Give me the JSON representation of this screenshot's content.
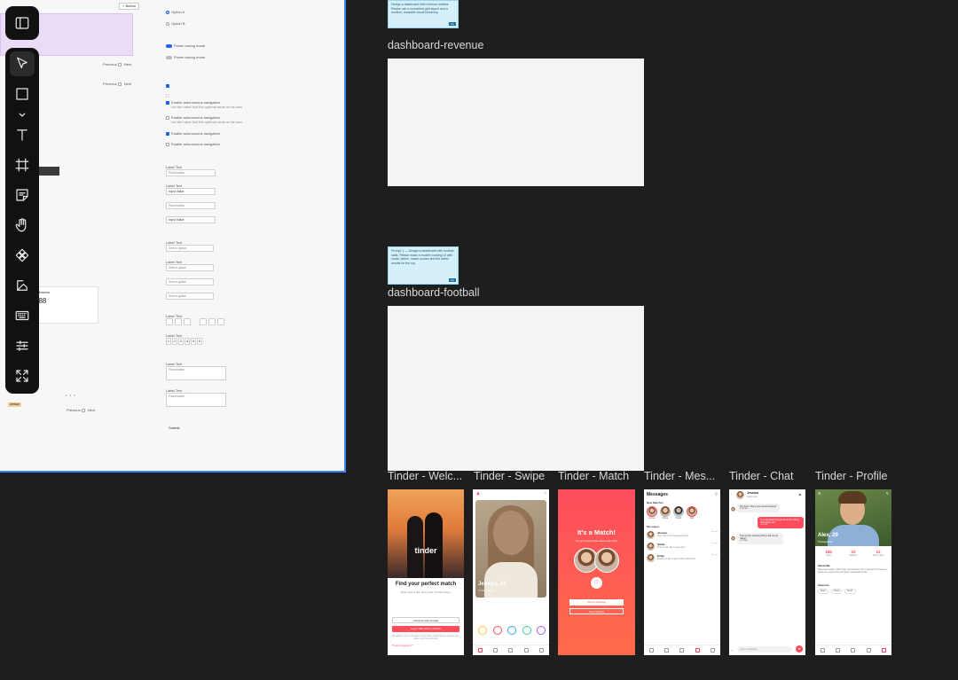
{
  "toolbar": {
    "tools": [
      {
        "name": "move-tool",
        "icon": "cursor-icon"
      },
      {
        "name": "rectangle-tool",
        "icon": "square-icon"
      },
      {
        "name": "text-tool",
        "icon": "text-icon"
      },
      {
        "name": "frame-tool",
        "icon": "frame-icon"
      },
      {
        "name": "sticky-note-tool",
        "icon": "sticky-note-icon"
      },
      {
        "name": "hand-tool",
        "icon": "hand-icon"
      },
      {
        "name": "component-tool",
        "icon": "component-icon"
      },
      {
        "name": "shapes-tool",
        "icon": "shapes-icon"
      },
      {
        "name": "keyboard-tool",
        "icon": "keyboard-icon"
      },
      {
        "name": "adjustments-tool",
        "icon": "sliders-icon"
      },
      {
        "name": "fullscreen-tool",
        "icon": "expand-icon"
      }
    ]
  },
  "artboard": {
    "add_label": "+ Button",
    "pager": {
      "prev": "Previous",
      "next": "Next"
    },
    "checkbox_labels": [
      "Enable autonomous navigation",
      "Enable autonomous navigation",
      "Enable autonomous navigation",
      "Enable autonomous navigation"
    ],
    "checkbox_help": "Let the robot find the optimal route on its own",
    "toggle_labels": [
      "Power saving mode",
      "Power saving mode"
    ],
    "radio_labels": [
      "Option A",
      "Option B"
    ],
    "field_label": "Label Text",
    "placeholder": "Placeholder",
    "input_value": "Input Value",
    "select_placeholder": "Select option",
    "stat_title": "Followers",
    "stat_value": "288",
    "small_button": "Submit",
    "footer_tag": "Default",
    "pager_bottom": {
      "prev": "Previous",
      "next": "Next"
    },
    "stepper_digits": [
      "1",
      "2",
      "3",
      "4",
      "5",
      "6"
    ]
  },
  "frames": {
    "revenue_label": "dashboard-revenue",
    "football_label": "dashboard-football",
    "prompt_revenue": "Design a dashboard with revenue metrics. Please use a consistent grid layout and a modern, readable visual hierarchy.",
    "prompt_football": "Prompt 1 — Design a dashboard with football stats. Please make a modern looking UI with cards, tables, match scores and the latest results for the top.",
    "prompt_button": "Go"
  },
  "tinder": {
    "labels": [
      "Tinder - Welc...",
      "Tinder - Swipe",
      "Tinder - Match",
      "Tinder - Mes...",
      "Tinder - Chat",
      "Tinder - Profile"
    ],
    "welcome": {
      "logo": "tinder",
      "headline": "Find your perfect match",
      "subtitle": "Swipe right to like, left to pass. It's that simple.",
      "google_button": "Continue with Google",
      "phone_button": "Log in with phone number",
      "terms": "By tapping Log in, you agree to our Terms. Learn how we process your data in our Privacy Policy.",
      "trouble": "Trouble logging in?"
    },
    "swipe": {
      "name": "Jessica, 24",
      "distance": "5 miles away"
    },
    "match": {
      "title": "It's a Match!",
      "subtitle": "You and Jessica have liked each other.",
      "send_button": "Send a Message",
      "keep_button": "Keep Swiping"
    },
    "messages": {
      "title": "Messages",
      "section_new": "New Matches",
      "section_msgs": "Messages",
      "matches": [
        "Emma",
        "Olivia",
        "Sarah",
        "Mia"
      ],
      "threads": [
        {
          "name": "Jessica",
          "preview": "Hey! How's your weekend going?",
          "time": "2m ago"
        },
        {
          "name": "Sarah",
          "preview": "That sounds like a great plan!",
          "time": "1h ago"
        },
        {
          "name": "Emily",
          "preview": "Would you like to grab coffee sometime?",
          "time": "3h ago"
        }
      ]
    },
    "chat": {
      "name": "Jessica",
      "status": "Active now",
      "messages": [
        {
          "side": "left",
          "text": "Hey there! How's your weekend going?",
          "time": "10:30 AM"
        },
        {
          "side": "right",
          "text": "It's going great! Just got back from hiking. How about you?",
          "time": "10:32 AM"
        },
        {
          "side": "left",
          "text": "That sounds amazing! Where did you go hiking?",
          "time": "10:33 AM"
        }
      ],
      "input_placeholder": "Type a message..."
    },
    "profile": {
      "name": "Alex, 29",
      "job": "Photographer",
      "stats": [
        {
          "value": "186",
          "label": "Likes"
        },
        {
          "value": "23",
          "label": "Matches"
        },
        {
          "value": "12",
          "label": "Super Likes"
        }
      ],
      "about_title": "About Me",
      "about_text": "Adventure seeker, coffee lover, and amateur chef. Looking for someone to share new experiences and good conversations with.",
      "interests_title": "Interests",
      "interests": [
        "Sport",
        "Travel",
        "Music"
      ]
    },
    "accent": "#fd4d5d"
  }
}
